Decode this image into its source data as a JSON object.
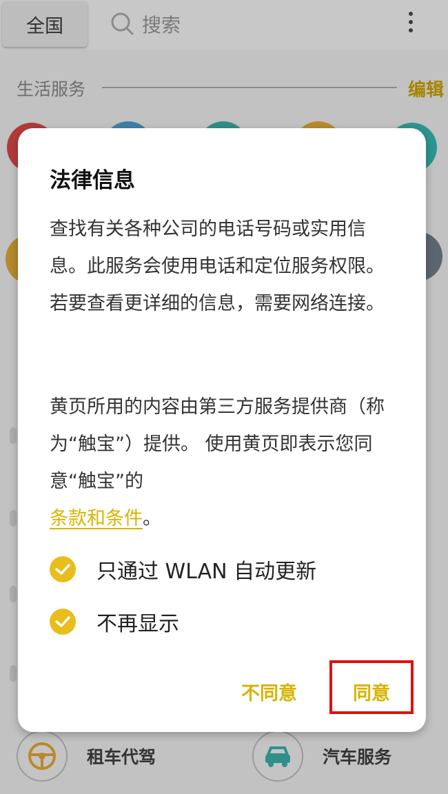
{
  "topbar": {
    "region_label": "全国",
    "search_placeholder": "搜索"
  },
  "section": {
    "title": "生活服务",
    "edit_label": "编辑"
  },
  "bottom_items": [
    {
      "label": "租车代驾",
      "icon": "steering-wheel-icon"
    },
    {
      "label": "汽车服务",
      "icon": "car-icon"
    }
  ],
  "dialog": {
    "title": "法律信息",
    "para1": "查找有关各种公司的电话号码或实用信息。此服务会使用电话和定位服务权限。若要查看更详细的信息，需要网络连接。",
    "para2_text": "黄页所用的内容由第三方服务提供商（称为“触宝”）提供。 使用黄页即表示您同意“触宝”的",
    "terms_link": "条款和条件",
    "para2_end": "。",
    "options": [
      {
        "label": "只通过 WLAN 自动更新",
        "checked": true
      },
      {
        "label": "不再显示",
        "checked": true
      }
    ],
    "disagree_label": "不同意",
    "agree_label": "同意"
  },
  "colors": {
    "accent": "#e9bd1b",
    "highlight_box": "#e01010"
  }
}
